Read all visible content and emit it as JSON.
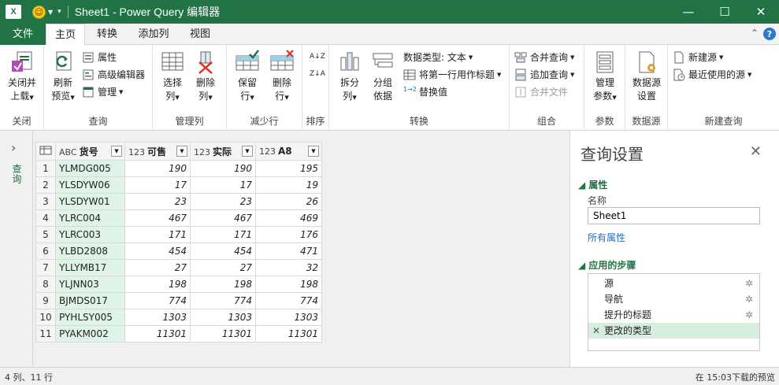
{
  "titlebar": {
    "app_icon_label": "X",
    "title": "Sheet1 - Power Query 编辑器",
    "minimize": "—",
    "restore": "☐",
    "close": "✕"
  },
  "tabs": {
    "file": "文件",
    "home": "主页",
    "transform": "转换",
    "add_column": "添加列",
    "view": "视图",
    "help": "?"
  },
  "ribbon": {
    "close_group": {
      "label": "关闭",
      "close_load": "关闭并",
      "close_load2": "上载"
    },
    "query_group": {
      "label": "查询",
      "refresh": "刷新",
      "refresh2": "预览",
      "properties": "属性",
      "advanced_editor": "高级编辑器",
      "manage": "管理"
    },
    "manage_cols_group": {
      "label": "管理列",
      "choose": "选择",
      "choose2": "列",
      "remove": "删除",
      "remove2": "列"
    },
    "reduce_rows_group": {
      "label": "减少行",
      "keep": "保留",
      "keep2": "行",
      "remove": "删除",
      "remove2": "行"
    },
    "sort_group": {
      "label": "排序",
      "asc": "A↓Z",
      "desc": "Z↓A"
    },
    "transform_group": {
      "label": "转换",
      "split": "拆分",
      "split2": "列",
      "group_by": "分组",
      "group_by2": "依据",
      "data_type": "数据类型: 文本",
      "first_row_header": "将第一行用作标题",
      "replace_values": "替换值",
      "replace_prefix": "1→2"
    },
    "combine_group": {
      "label": "组合",
      "merge": "合并查询",
      "append": "追加查询",
      "combine_files": "合并文件"
    },
    "params_group": {
      "label": "参数",
      "manage": "管理",
      "manage2": "参数"
    },
    "datasource_group": {
      "label": "数据源",
      "settings": "数据源",
      "settings2": "设置"
    },
    "newquery_group": {
      "label": "新建查询",
      "new_source": "新建源",
      "recent_sources": "最近使用的源"
    }
  },
  "left_pane": {
    "chevron": "›",
    "label": "查询"
  },
  "grid": {
    "headers": [
      {
        "type": "ABC",
        "name": "货号"
      },
      {
        "type": "123",
        "name": "可售"
      },
      {
        "type": "123",
        "name": "实际"
      },
      {
        "type": "123",
        "name": "A8"
      }
    ],
    "rows": [
      [
        "1",
        "YLMDG005",
        "190",
        "190",
        "195"
      ],
      [
        "2",
        "YLSDYW06",
        "17",
        "17",
        "19"
      ],
      [
        "3",
        "YLSDYW01",
        "23",
        "23",
        "26"
      ],
      [
        "4",
        "YLRC004",
        "467",
        "467",
        "469"
      ],
      [
        "5",
        "YLRC003",
        "171",
        "171",
        "176"
      ],
      [
        "6",
        "YLBD2808",
        "454",
        "454",
        "471"
      ],
      [
        "7",
        "YLLYMB17",
        "27",
        "27",
        "32"
      ],
      [
        "8",
        "YLJNN03",
        "198",
        "198",
        "198"
      ],
      [
        "9",
        "BJMDS017",
        "774",
        "774",
        "774"
      ],
      [
        "10",
        "PYHLSY005",
        "1303",
        "1303",
        "1303"
      ],
      [
        "11",
        "PYAKM002",
        "11301",
        "11301",
        "11301"
      ]
    ]
  },
  "query_settings": {
    "title": "查询设置",
    "close": "✕",
    "properties_header": "属性",
    "name_label": "名称",
    "name_value": "Sheet1",
    "all_properties": "所有属性",
    "steps_header": "应用的步骤",
    "steps": [
      "源",
      "导航",
      "提升的标题",
      "更改的类型"
    ],
    "gear": "✲",
    "delete": "✕"
  },
  "status": {
    "left": "4 列、11 行",
    "right": "在 15:03下载的预览"
  }
}
